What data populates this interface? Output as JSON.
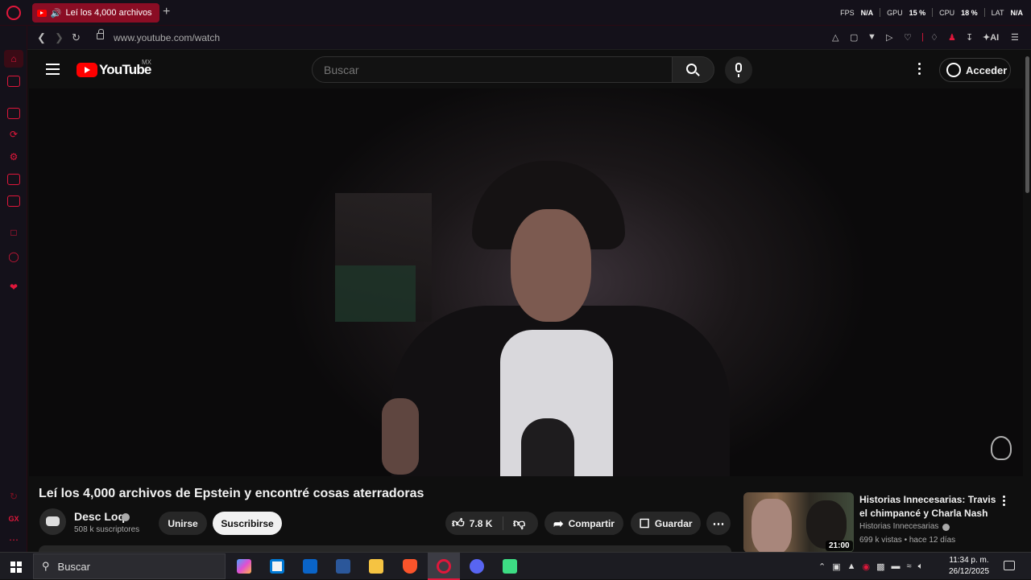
{
  "browser": {
    "tab_title": "Leí los 4,000 archivos",
    "new_tab": "+",
    "url": "www.youtube.com/watch",
    "hud": {
      "fps_label": "FPS",
      "fps_value": "N/A",
      "gpu_label": "GPU",
      "gpu_value": "15 %",
      "cpu_label": "CPU",
      "cpu_value": "18 %",
      "lat_label": "LAT",
      "lat_value": "N/A"
    },
    "toolbar_ai": "AI"
  },
  "youtube": {
    "logo_text": "YouTube",
    "region": "MX",
    "search_placeholder": "Buscar",
    "signin_label": "Acceder"
  },
  "video": {
    "title": "Leí los 4,000 archivos de Epstein y encontré cosas aterradoras",
    "channel_name": "Desc Loq",
    "subscribers": "508 k suscriptores",
    "join_label": "Unirse",
    "subscribe_label": "Suscribirse",
    "likes": "7.8 K",
    "share_label": "Compartir",
    "save_label": "Guardar"
  },
  "recommendation": {
    "title": "Historias Innecesarias: Travis el chimpancé y Charla Nash",
    "channel": "Historias Innecesarias",
    "meta": "699 k vistas • hace 12 días",
    "duration": "21:00"
  },
  "taskbar": {
    "search_label": "Buscar",
    "time": "11:34 p. m.",
    "date": "26/12/2025"
  },
  "colors": {
    "opera_accent": "#e0173b",
    "youtube_red": "#ff0000",
    "background": "#0f0f0f"
  }
}
